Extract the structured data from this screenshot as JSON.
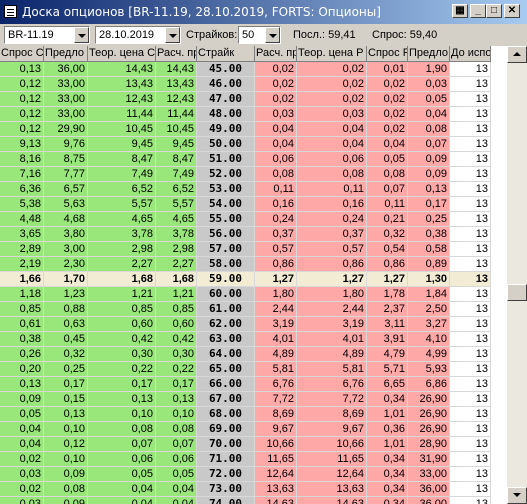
{
  "window": {
    "title": "Доска опционов [BR-11.19, 28.10.2019, FORTS: Опционы]"
  },
  "toolbar": {
    "instrument": "BR-11.19",
    "date": "28.10.2019",
    "strikes_label": "Страйков:",
    "strikes_value": "50",
    "last": "Посл.: 59,41",
    "demand": "Спрос: 59,40"
  },
  "columns": [
    "Спрос C",
    "Предло",
    "Теор. цена C",
    "Расч. пр",
    "Страйк",
    "Расч. пр",
    "Теор. цена P",
    "Спрос P",
    "Предло",
    "До испо"
  ],
  "rows": [
    [
      "0,13",
      "36,00",
      "14,43",
      "14,43",
      "45.00",
      "0,02",
      "0,02",
      "0,01",
      "1,90",
      "13"
    ],
    [
      "0,12",
      "33,00",
      "13,43",
      "13,43",
      "46.00",
      "0,02",
      "0,02",
      "0,02",
      "0,03",
      "13"
    ],
    [
      "0,12",
      "33,00",
      "12,43",
      "12,43",
      "47.00",
      "0,02",
      "0,02",
      "0,02",
      "0,05",
      "13"
    ],
    [
      "0,12",
      "33,00",
      "11,44",
      "11,44",
      "48.00",
      "0,03",
      "0,03",
      "0,02",
      "0,04",
      "13"
    ],
    [
      "0,12",
      "29,90",
      "10,45",
      "10,45",
      "49.00",
      "0,04",
      "0,04",
      "0,02",
      "0,08",
      "13"
    ],
    [
      "9,13",
      "9,76",
      "9,45",
      "9,45",
      "50.00",
      "0,04",
      "0,04",
      "0,04",
      "0,07",
      "13"
    ],
    [
      "8,16",
      "8,75",
      "8,47",
      "8,47",
      "51.00",
      "0,06",
      "0,06",
      "0,05",
      "0,09",
      "13"
    ],
    [
      "7,16",
      "7,77",
      "7,49",
      "7,49",
      "52.00",
      "0,08",
      "0,08",
      "0,08",
      "0,09",
      "13"
    ],
    [
      "6,36",
      "6,57",
      "6,52",
      "6,52",
      "53.00",
      "0,11",
      "0,11",
      "0,07",
      "0,13",
      "13"
    ],
    [
      "5,38",
      "5,63",
      "5,57",
      "5,57",
      "54.00",
      "0,16",
      "0,16",
      "0,11",
      "0,17",
      "13"
    ],
    [
      "4,48",
      "4,68",
      "4,65",
      "4,65",
      "55.00",
      "0,24",
      "0,24",
      "0,21",
      "0,25",
      "13"
    ],
    [
      "3,65",
      "3,80",
      "3,78",
      "3,78",
      "56.00",
      "0,37",
      "0,37",
      "0,32",
      "0,38",
      "13"
    ],
    [
      "2,89",
      "3,00",
      "2,98",
      "2,98",
      "57.00",
      "0,57",
      "0,57",
      "0,54",
      "0,58",
      "13"
    ],
    [
      "2,19",
      "2,30",
      "2,27",
      "2,27",
      "58.00",
      "0,86",
      "0,86",
      "0,86",
      "0,89",
      "13"
    ],
    [
      "1,66",
      "1,70",
      "1,68",
      "1,68",
      "59.00",
      "1,27",
      "1,27",
      "1,27",
      "1,30",
      "13"
    ],
    [
      "1,18",
      "1,23",
      "1,21",
      "1,21",
      "60.00",
      "1,80",
      "1,80",
      "1,78",
      "1,84",
      "13"
    ],
    [
      "0,85",
      "0,88",
      "0,85",
      "0,85",
      "61.00",
      "2,44",
      "2,44",
      "2,37",
      "2,50",
      "13"
    ],
    [
      "0,61",
      "0,63",
      "0,60",
      "0,60",
      "62.00",
      "3,19",
      "3,19",
      "3,11",
      "3,27",
      "13"
    ],
    [
      "0,38",
      "0,45",
      "0,42",
      "0,42",
      "63.00",
      "4,01",
      "4,01",
      "3,91",
      "4,10",
      "13"
    ],
    [
      "0,26",
      "0,32",
      "0,30",
      "0,30",
      "64.00",
      "4,89",
      "4,89",
      "4,79",
      "4,99",
      "13"
    ],
    [
      "0,20",
      "0,25",
      "0,22",
      "0,22",
      "65.00",
      "5,81",
      "5,81",
      "5,71",
      "5,93",
      "13"
    ],
    [
      "0,13",
      "0,17",
      "0,17",
      "0,17",
      "66.00",
      "6,76",
      "6,76",
      "6,65",
      "6,86",
      "13"
    ],
    [
      "0,09",
      "0,15",
      "0,13",
      "0,13",
      "67.00",
      "7,72",
      "7,72",
      "0,34",
      "26,90",
      "13"
    ],
    [
      "0,05",
      "0,13",
      "0,10",
      "0,10",
      "68.00",
      "8,69",
      "8,69",
      "1,01",
      "26,90",
      "13"
    ],
    [
      "0,04",
      "0,10",
      "0,08",
      "0,08",
      "69.00",
      "9,67",
      "9,67",
      "0,36",
      "26,90",
      "13"
    ],
    [
      "0,04",
      "0,12",
      "0,07",
      "0,07",
      "70.00",
      "10,66",
      "10,66",
      "1,01",
      "28,90",
      "13"
    ],
    [
      "0,02",
      "0,10",
      "0,06",
      "0,06",
      "71.00",
      "11,65",
      "11,65",
      "0,34",
      "31,90",
      "13"
    ],
    [
      "0,03",
      "0,09",
      "0,05",
      "0,05",
      "72.00",
      "12,64",
      "12,64",
      "0,34",
      "33,00",
      "13"
    ],
    [
      "0,02",
      "0,08",
      "0,04",
      "0,04",
      "73.00",
      "13,63",
      "13,63",
      "0,34",
      "36,00",
      "13"
    ],
    [
      "0,03",
      "0,09",
      "0,04",
      "0,04",
      "74.00",
      "14,63",
      "14,63",
      "0,34",
      "36,00",
      "13"
    ]
  ],
  "current_row_index": 14,
  "colors": {
    "call": "#99e67a",
    "put": "#ffa8a8",
    "strike": "#c9c9c9",
    "current": "#f3ecd5"
  }
}
